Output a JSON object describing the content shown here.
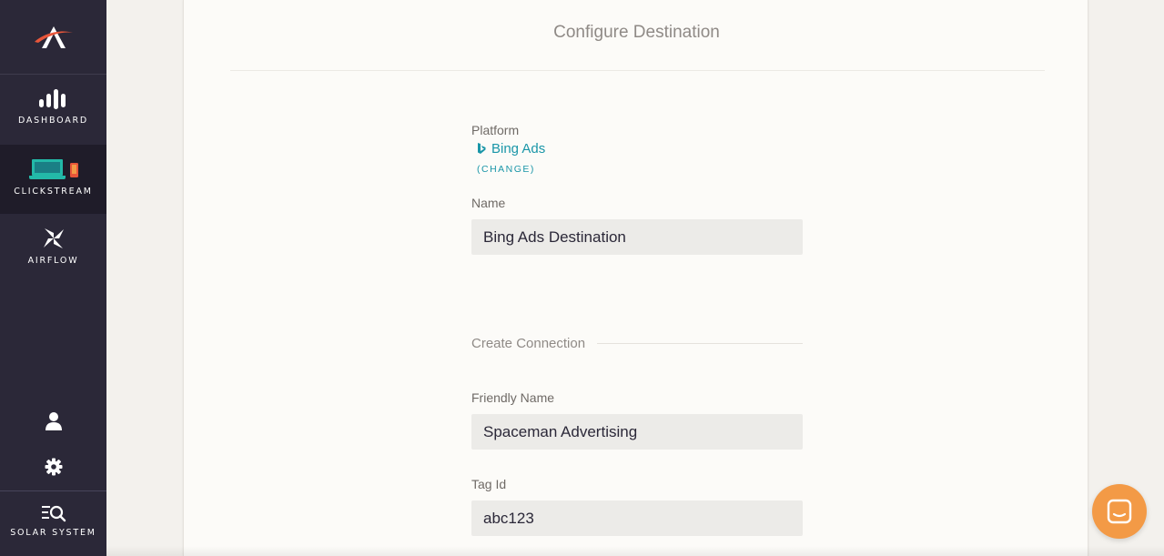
{
  "sidebar": {
    "logo_name": "astronomer-logo",
    "items": [
      {
        "label": "DASHBOARD",
        "icon": "bar-chart-icon"
      },
      {
        "label": "CLICKSTREAM",
        "icon": "laptop-phone-icon",
        "active": true
      },
      {
        "label": "AIRFLOW",
        "icon": "pinwheel-icon"
      }
    ],
    "bottom": {
      "user_icon": "user-icon",
      "settings_icon": "gear-icon",
      "solar_label": "SOLAR SYSTEM",
      "solar_icon": "list-search-icon"
    }
  },
  "page": {
    "title": "Configure Destination"
  },
  "form": {
    "platform_label": "Platform",
    "platform_value": "Bing Ads",
    "platform_icon": "bing-icon",
    "change_label": "(CHANGE)",
    "name_label": "Name",
    "name_value": "Bing Ads Destination",
    "section_title": "Create Connection",
    "friendly_label": "Friendly Name",
    "friendly_value": "Spaceman Advertising",
    "tag_label": "Tag Id",
    "tag_value": "abc123"
  },
  "chat": {
    "icon": "chat-icon"
  },
  "colors": {
    "sidebar_bg": "#2b2838",
    "accent_teal": "#1a96a8",
    "chat_orange": "#f39a46"
  }
}
